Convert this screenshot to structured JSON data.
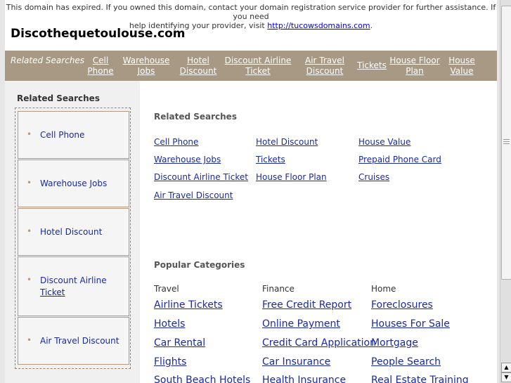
{
  "notice": {
    "line1": "This domain has expired. If you owned this domain, contact your domain registration service provider for further assistance. If you need",
    "line2_prefix": "help identifying your provider, visit ",
    "link": "http://tucowsdomains.com",
    "line2_suffix": "."
  },
  "domain_title": "Discothequetoulouse.com",
  "nav": {
    "label": "Related Searches",
    "links": [
      {
        "line1": "Cell",
        "line2": "Phone"
      },
      {
        "line1": "Warehouse",
        "line2": "Jobs"
      },
      {
        "line1": "Hotel",
        "line2": "Discount"
      },
      {
        "line1": "Discount Airline",
        "line2": "Ticket"
      },
      {
        "line1": "Air Travel",
        "line2": "Discount"
      },
      {
        "line1": "Tickets",
        "line2": ""
      },
      {
        "line1": "House Floor",
        "line2": "Plan"
      },
      {
        "line1": "House",
        "line2": "Value"
      }
    ]
  },
  "sidebar": {
    "heading": "Related Searches",
    "items": [
      {
        "line1": "Cell Phone",
        "line2": ""
      },
      {
        "line1": "Warehouse Jobs",
        "line2": ""
      },
      {
        "line1": "Hotel Discount",
        "line2": ""
      },
      {
        "line1": "Discount Airline",
        "line2": "Ticket"
      },
      {
        "line1": "Air Travel Discount",
        "line2": ""
      }
    ]
  },
  "related": {
    "heading": "Related Searches",
    "col1": [
      "Cell Phone",
      "Warehouse Jobs",
      "Discount Airline Ticket",
      "Air Travel Discount"
    ],
    "col2": [
      "Hotel Discount",
      "Tickets",
      "House Floor Plan"
    ],
    "col3": [
      "House Value",
      "Prepaid Phone Card",
      "Cruises"
    ]
  },
  "popular": {
    "heading": "Popular Categories",
    "categories": [
      {
        "name": "Travel",
        "links": [
          "Airline Tickets",
          "Hotels",
          "Car Rental",
          "Flights",
          "South Beach Hotels"
        ]
      },
      {
        "name": "Finance",
        "links": [
          "Free Credit Report",
          "Online Payment",
          "Credit Card Application",
          "Car Insurance",
          "Health Insurance"
        ]
      },
      {
        "name": "Home",
        "links": [
          "Foreclosures",
          "Houses For Sale",
          "Mortgage",
          "People Search",
          "Real Estate Training"
        ]
      }
    ]
  },
  "scrollbar": {
    "up_arrow": "▲",
    "down_arrow": "▼"
  }
}
